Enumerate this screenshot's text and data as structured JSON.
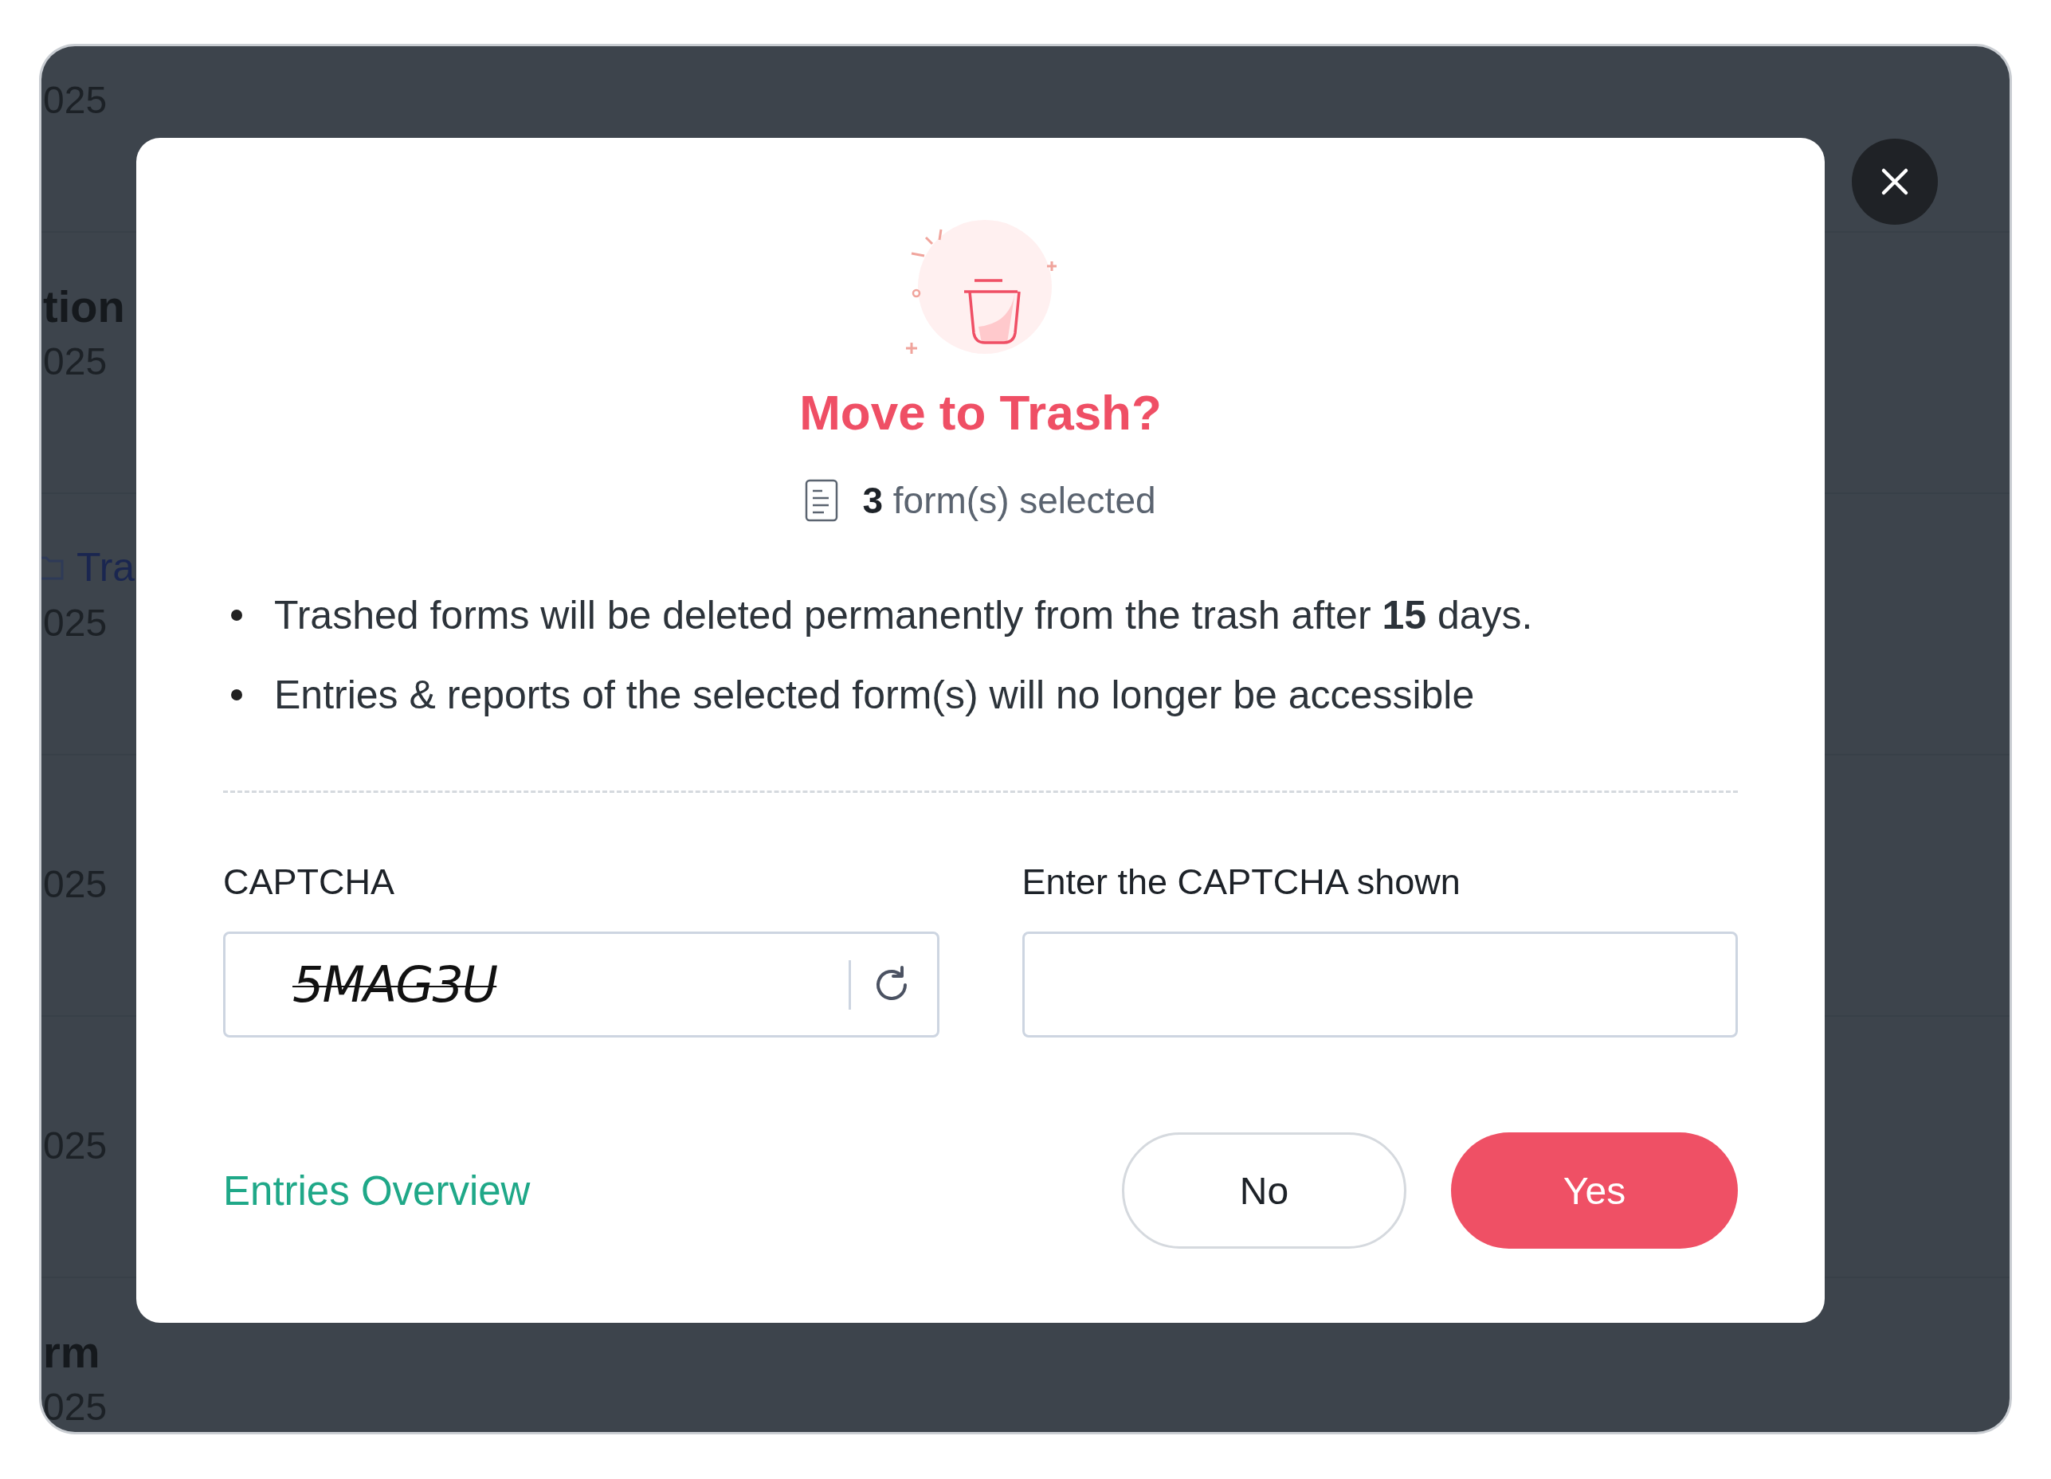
{
  "background": {
    "rows": [
      {
        "kind": "plain",
        "date": "025"
      },
      {
        "kind": "heading",
        "title": "tion",
        "date": "025"
      },
      {
        "kind": "link",
        "title": "Tra",
        "date": "025"
      },
      {
        "kind": "plain",
        "date": "025"
      },
      {
        "kind": "plain",
        "date": "025"
      },
      {
        "kind": "heading",
        "title": "rm",
        "date": "025"
      }
    ]
  },
  "dialog": {
    "title": "Move to Trash?",
    "subtitle": "**3** form(s) selected",
    "notes": [
      "Trashed forms will be deleted permanently from the trash after **15** days.",
      "Entries & reports of the selected form(s) will no longer be accessible"
    ],
    "captcha": {
      "label": "CAPTCHA",
      "value": "5MAG3U"
    },
    "answer": {
      "label": "Enter the CAPTCHA shown"
    },
    "link": "Entries Overview",
    "buttons": [
      {
        "label": "No",
        "kind": "secondary"
      },
      {
        "label": "Yes",
        "kind": "primary"
      }
    ]
  }
}
